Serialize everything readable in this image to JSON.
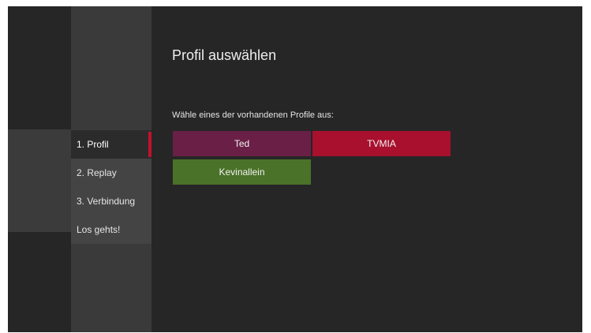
{
  "page": {
    "title": "Profil auswählen",
    "subtitle": "Wähle eines der vorhandenen Profile aus:"
  },
  "nav": {
    "items": [
      {
        "label": "1. Profil",
        "active": true
      },
      {
        "label": "2. Replay",
        "active": false
      },
      {
        "label": "3. Verbindung",
        "active": false
      },
      {
        "label": "Los gehts!",
        "active": false
      }
    ]
  },
  "profiles": [
    {
      "name": "Ted",
      "color": "#6a1f46"
    },
    {
      "name": "TVMIA",
      "color": "#a8102e"
    },
    {
      "name": "Kevinallein",
      "color": "#4a7228"
    }
  ],
  "colors": {
    "background": "#262626",
    "nav_background": "#3a3a3a",
    "accent": "#c2102e"
  }
}
